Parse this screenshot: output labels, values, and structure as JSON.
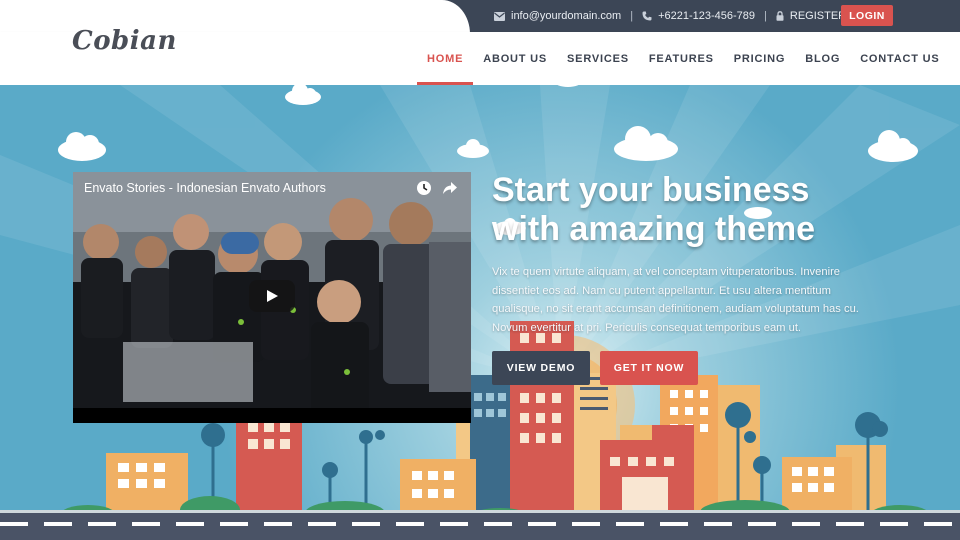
{
  "topbar": {
    "email": "info@yourdomain.com",
    "phone": "+6221-123-456-789",
    "register": "REGISTER",
    "login": "LOGIN",
    "separator": "|"
  },
  "brand": {
    "logo": "Cobian"
  },
  "nav": {
    "items": [
      {
        "label": "HOME",
        "active": true
      },
      {
        "label": "ABOUT US",
        "active": false
      },
      {
        "label": "SERVICES",
        "active": false
      },
      {
        "label": "FEATURES",
        "active": false
      },
      {
        "label": "PRICING",
        "active": false
      },
      {
        "label": "BLOG",
        "active": false
      },
      {
        "label": "CONTACT US",
        "active": false
      }
    ]
  },
  "video": {
    "title": "Envato Stories - Indonesian Envato Authors",
    "icons": [
      "clock-icon",
      "share-icon",
      "play-icon"
    ]
  },
  "hero": {
    "headline_line1": "Start your business",
    "headline_line2": "with amazing theme",
    "description": "Vix te quem virtute aliquam, at vel conceptam vituperatoribus. Invenire dissentiet eos ad. Nam cu putent appellantur. Et usu altera mentitum qualisque, no sit erant accumsan definitionem, audiam voluptatum has cu. Novum evertitur at pri. Periculis consequat temporibus eam ut.",
    "primary_button": "VIEW DEMO",
    "secondary_button": "GET IT NOW"
  },
  "colors": {
    "accent": "#d9534f",
    "dark": "#3c4656",
    "sky": "#5aaac8"
  }
}
